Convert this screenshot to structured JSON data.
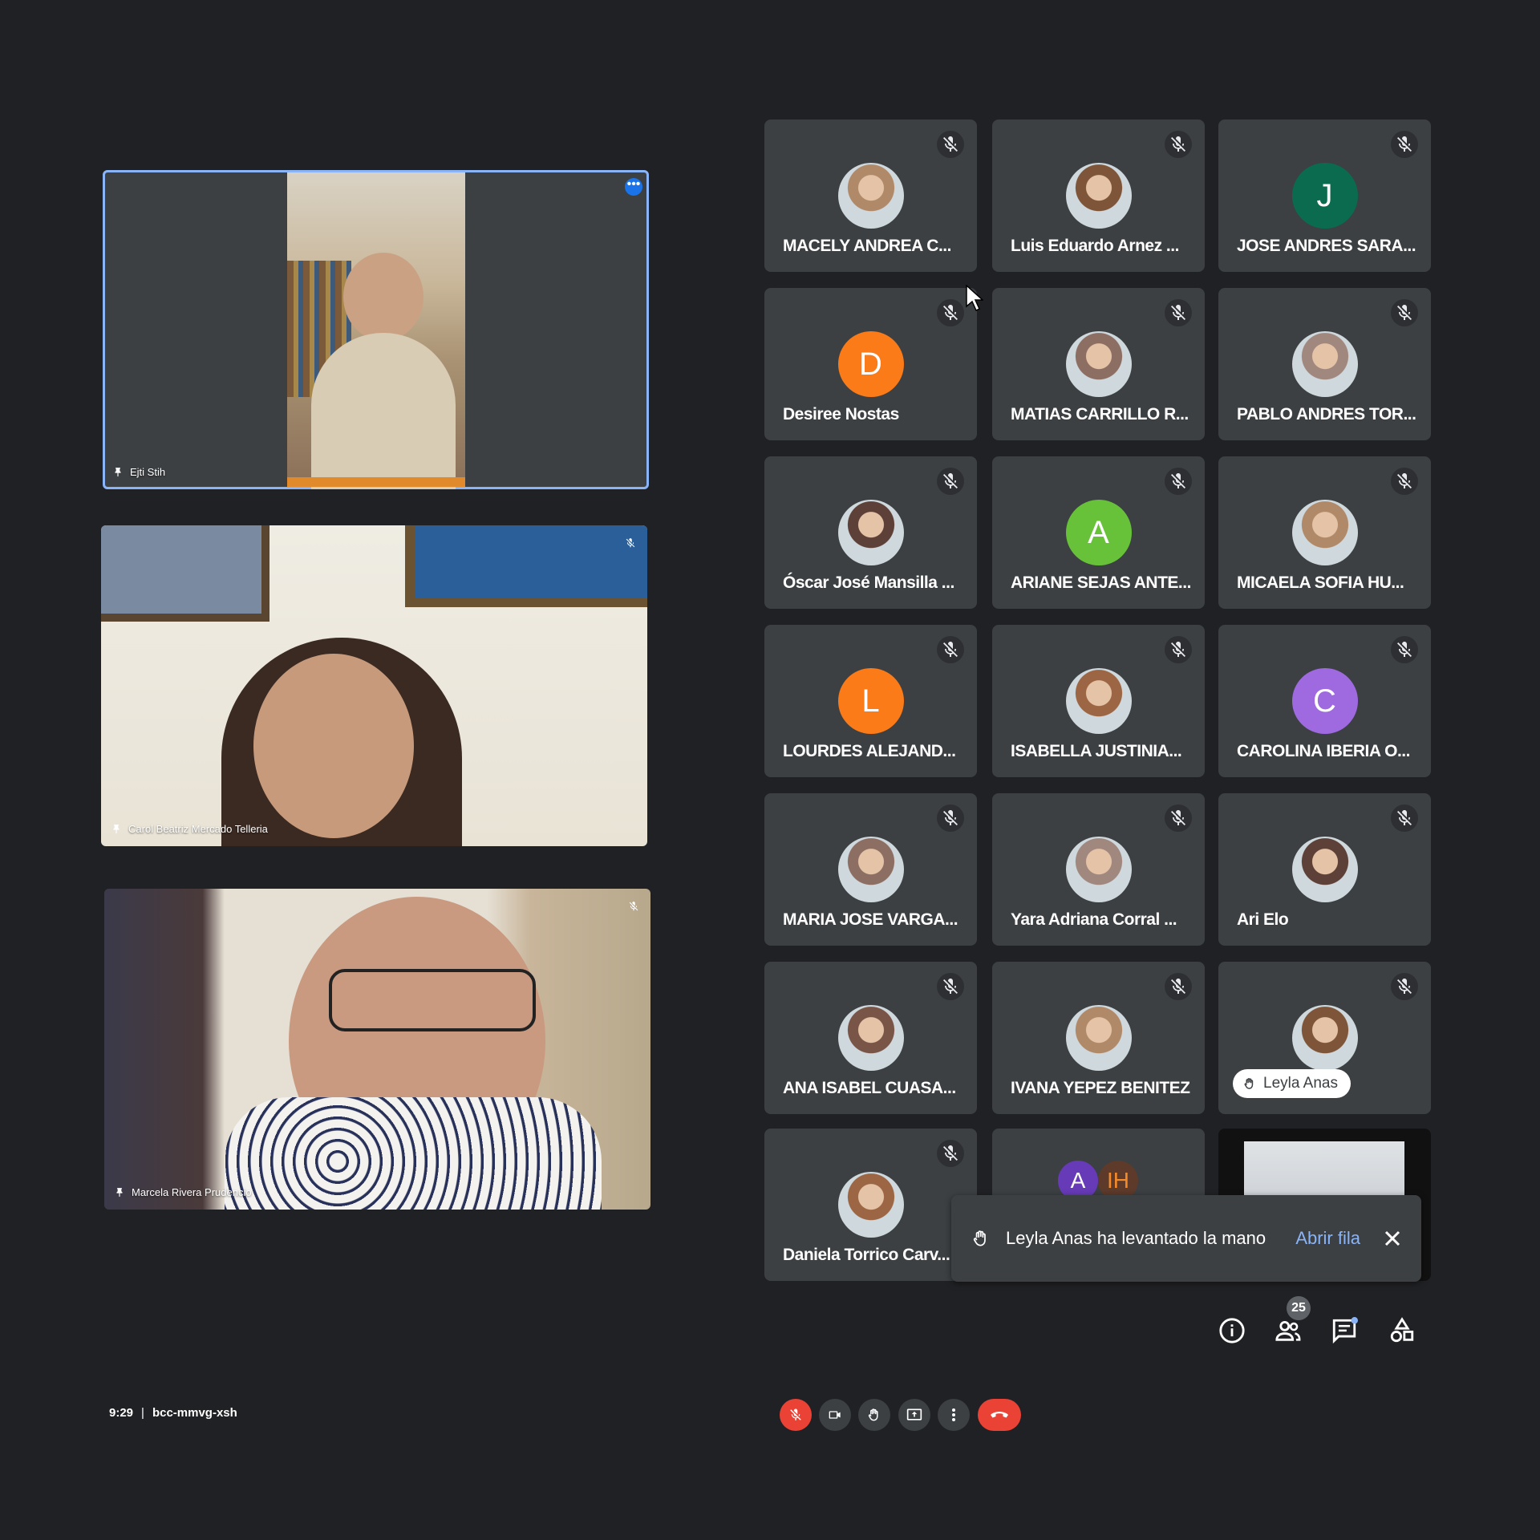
{
  "featured": [
    {
      "name": "Ejti Stih",
      "menu_glyph": "•••"
    },
    {
      "name": "Carol Beatriz Mercado Telleria"
    },
    {
      "name": "Marcela Rivera Prudencio"
    }
  ],
  "participants": [
    {
      "name": "MACELY ANDREA C...",
      "avatar": "photo"
    },
    {
      "name": "Luis Eduardo Arnez ...",
      "avatar": "photo"
    },
    {
      "name": "JOSE ANDRES SARA...",
      "avatar": "letter",
      "letter": "J",
      "color": "#0b6b4f"
    },
    {
      "name": "Desiree Nostas",
      "avatar": "letter",
      "letter": "D",
      "color": "#fa7b17"
    },
    {
      "name": "MATIAS CARRILLO R...",
      "avatar": "photo"
    },
    {
      "name": "PABLO ANDRES TOR...",
      "avatar": "photo"
    },
    {
      "name": "Óscar José Mansilla ...",
      "avatar": "photo"
    },
    {
      "name": "ARIANE SEJAS ANTE...",
      "avatar": "letter",
      "letter": "A",
      "color": "#67c23a"
    },
    {
      "name": "MICAELA SOFIA HU...",
      "avatar": "photo"
    },
    {
      "name": "LOURDES ALEJAND...",
      "avatar": "letter",
      "letter": "L",
      "color": "#fa7b17"
    },
    {
      "name": "ISABELLA JUSTINIA...",
      "avatar": "photo"
    },
    {
      "name": "CAROLINA IBERIA O...",
      "avatar": "letter",
      "letter": "C",
      "color": "#9f6ae0"
    },
    {
      "name": "MARIA JOSE VARGA...",
      "avatar": "photo"
    },
    {
      "name": "Yara Adriana Corral ...",
      "avatar": "photo"
    },
    {
      "name": "Ari Elo",
      "avatar": "photo"
    },
    {
      "name": "ANA ISABEL CUASA...",
      "avatar": "photo"
    },
    {
      "name": "IVANA YEPEZ BENITEZ",
      "avatar": "photo"
    },
    {
      "name": "Leyla Anas",
      "avatar": "photo",
      "hand_raised": true
    },
    {
      "name": "Daniela Torrico Carv...",
      "avatar": "photo"
    }
  ],
  "toast": {
    "message": "Leyla Anas ha levantado la mano",
    "action": "Abrir fila"
  },
  "overflow_avatars": [
    "A",
    "IH"
  ],
  "people_count": "25",
  "meeting": {
    "time": "9:29",
    "code": "bcc-mmvg-xsh"
  },
  "colors": {
    "background": "#202124",
    "tile": "#3c4043",
    "accent": "#8ab4f8",
    "danger": "#ea4335"
  }
}
